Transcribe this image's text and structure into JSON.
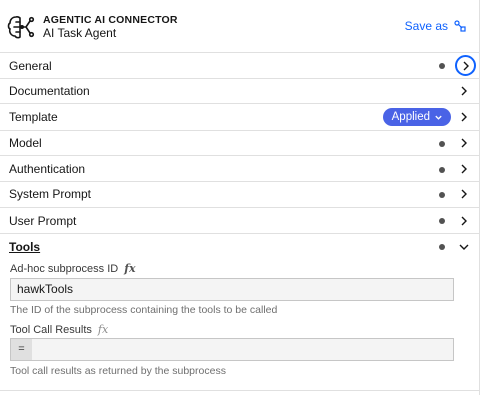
{
  "header": {
    "type_label": "AGENTIC AI CONNECTOR",
    "name_label": "AI Task Agent",
    "save_as_label": "Save as",
    "logo_icon": "ai-agent-logo-icon",
    "save_as_icon": "template-icon"
  },
  "groups": [
    {
      "label": "General",
      "has_dot": true,
      "state": "collapsed",
      "focused": true
    },
    {
      "label": "Documentation",
      "has_dot": false,
      "state": "collapsed"
    },
    {
      "label": "Template",
      "has_dot": false,
      "state": "collapsed",
      "badge": "Applied"
    },
    {
      "label": "Model",
      "has_dot": true,
      "state": "collapsed"
    },
    {
      "label": "Authentication",
      "has_dot": true,
      "state": "collapsed"
    },
    {
      "label": "System Prompt",
      "has_dot": true,
      "state": "collapsed"
    },
    {
      "label": "User Prompt",
      "has_dot": true,
      "state": "collapsed"
    },
    {
      "label": "Tools",
      "has_dot": true,
      "state": "expanded"
    }
  ],
  "tools": {
    "subprocess_id": {
      "label": "Ad-hoc subprocess ID",
      "fx": "fx",
      "value": "hawkTools",
      "helper": "The ID of the subprocess containing the tools to be called"
    },
    "tool_call_results": {
      "label": "Tool Call Results",
      "fx": "fx",
      "feel_prefix": "=",
      "value": "",
      "helper": "Tool call results as returned by the subprocess"
    }
  },
  "colors": {
    "accent": "#0f62fe",
    "applied_badge": "#4a63e6",
    "divider": "#e0e0e0",
    "text": "#161616"
  }
}
